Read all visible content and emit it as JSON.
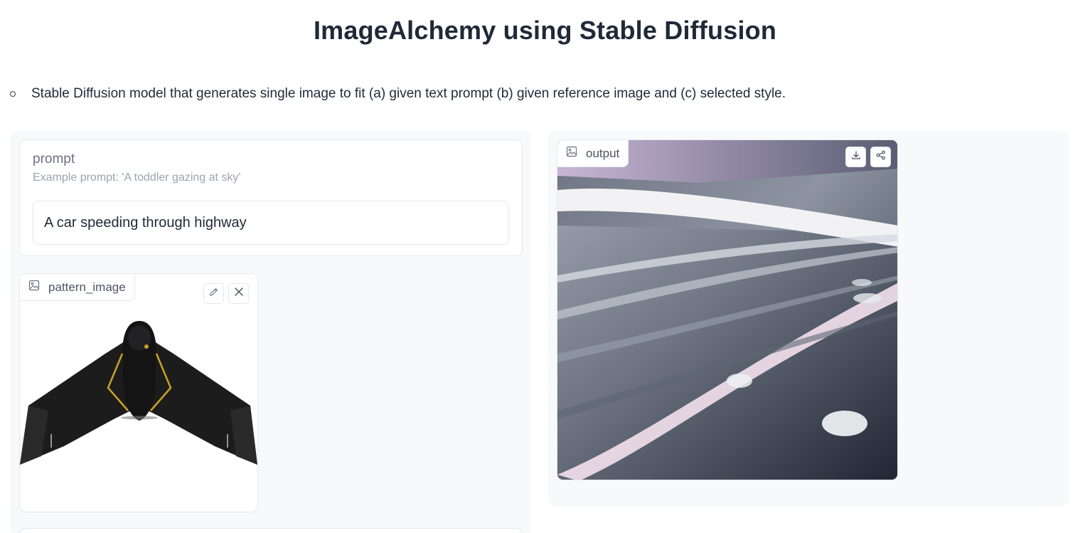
{
  "page": {
    "title": "ImageAlchemy using Stable Diffusion",
    "description": "Stable Diffusion model that generates single image to fit (a) given text prompt (b) given reference image and (c) selected style."
  },
  "prompt": {
    "label": "prompt",
    "info": "Example prompt: 'A toddler gazing at sky'",
    "value": "A car speeding through highway"
  },
  "pattern_image": {
    "label": "pattern_image",
    "icon": "image-icon",
    "edit_icon": "pencil-icon",
    "clear_icon": "close-icon"
  },
  "output": {
    "label": "output",
    "icon": "image-icon",
    "download_icon": "download-icon",
    "share_icon": "share-icon"
  },
  "colors": {
    "panel_bg": "#f8f9fb",
    "border": "#e5e7eb",
    "text": "#1f2937",
    "muted": "#6b7280"
  }
}
